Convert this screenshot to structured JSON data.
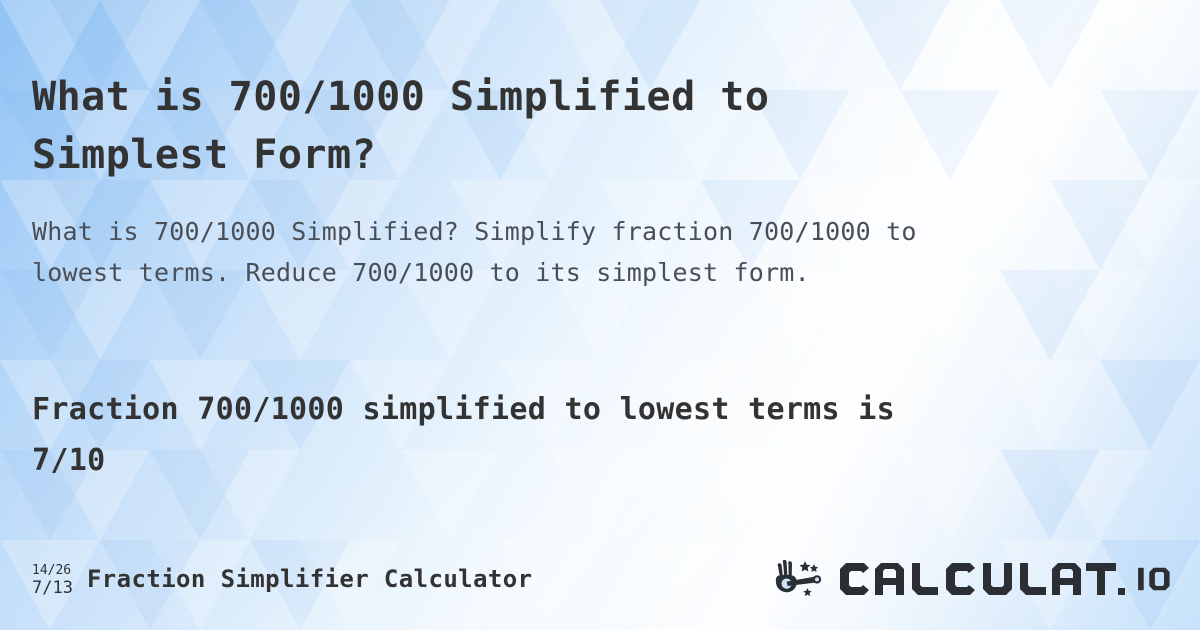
{
  "page": {
    "title_line1": "What is 700/1000 Simplified to",
    "title_line2": "Simplest Form?",
    "title_full": "What is 700/1000 Simplified to Simplest Form?",
    "subtitle_line1": "What is 700/1000 Simplified? Simplify fraction 700/1000 to",
    "subtitle_line2": "lowest terms. Reduce 700/1000 to its simplest form.",
    "subtitle_full": "What is 700/1000 Simplified? Simplify fraction 700/1000 to lowest terms. Reduce 700/1000 to its simplest form.",
    "result_line1": "Fraction 700/1000 simplified to lowest terms is",
    "result_line2": "7/10",
    "result_full": "Fraction 700/1000 simplified to lowest terms is 7/10"
  },
  "values": {
    "input_fraction": "700/1000",
    "input_numerator": "700",
    "input_denominator": "1000",
    "simplified_fraction": "7/10",
    "simplified_numerator": "7",
    "simplified_denominator": "10"
  },
  "footer": {
    "logo_icon_top": "14/26",
    "logo_icon_bottom": "7/13",
    "calculator_name": "Fraction Simplifier Calculator",
    "brand_name": "CALCULAT.IO",
    "brand_icon": "magic-wand-hand-icon"
  },
  "colors": {
    "text_dark": "#333333",
    "text_muted": "#4a4f57",
    "background_blue_dark": "#8fc2f5",
    "background_blue_light": "#fbfdff",
    "brand_dark": "#2b2f33"
  }
}
